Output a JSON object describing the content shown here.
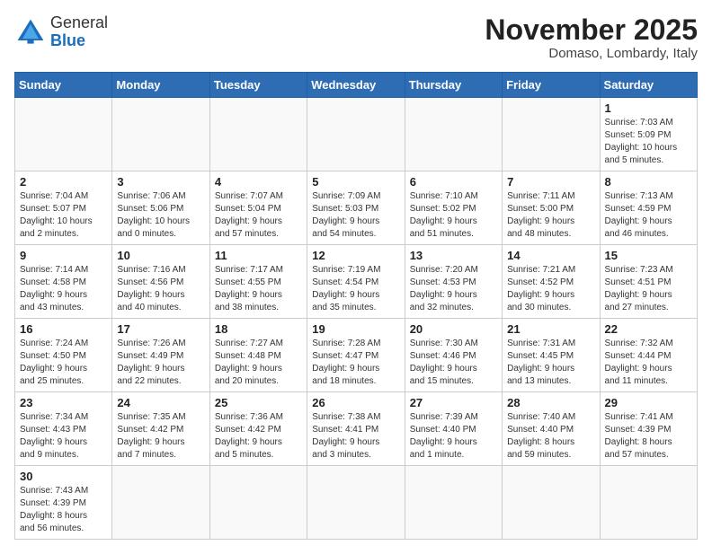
{
  "header": {
    "logo_general": "General",
    "logo_blue": "Blue",
    "month_title": "November 2025",
    "location": "Domaso, Lombardy, Italy"
  },
  "days_of_week": [
    "Sunday",
    "Monday",
    "Tuesday",
    "Wednesday",
    "Thursday",
    "Friday",
    "Saturday"
  ],
  "weeks": [
    [
      {
        "day": "",
        "info": ""
      },
      {
        "day": "",
        "info": ""
      },
      {
        "day": "",
        "info": ""
      },
      {
        "day": "",
        "info": ""
      },
      {
        "day": "",
        "info": ""
      },
      {
        "day": "",
        "info": ""
      },
      {
        "day": "1",
        "info": "Sunrise: 7:03 AM\nSunset: 5:09 PM\nDaylight: 10 hours\nand 5 minutes."
      }
    ],
    [
      {
        "day": "2",
        "info": "Sunrise: 7:04 AM\nSunset: 5:07 PM\nDaylight: 10 hours\nand 2 minutes."
      },
      {
        "day": "3",
        "info": "Sunrise: 7:06 AM\nSunset: 5:06 PM\nDaylight: 10 hours\nand 0 minutes."
      },
      {
        "day": "4",
        "info": "Sunrise: 7:07 AM\nSunset: 5:04 PM\nDaylight: 9 hours\nand 57 minutes."
      },
      {
        "day": "5",
        "info": "Sunrise: 7:09 AM\nSunset: 5:03 PM\nDaylight: 9 hours\nand 54 minutes."
      },
      {
        "day": "6",
        "info": "Sunrise: 7:10 AM\nSunset: 5:02 PM\nDaylight: 9 hours\nand 51 minutes."
      },
      {
        "day": "7",
        "info": "Sunrise: 7:11 AM\nSunset: 5:00 PM\nDaylight: 9 hours\nand 48 minutes."
      },
      {
        "day": "8",
        "info": "Sunrise: 7:13 AM\nSunset: 4:59 PM\nDaylight: 9 hours\nand 46 minutes."
      }
    ],
    [
      {
        "day": "9",
        "info": "Sunrise: 7:14 AM\nSunset: 4:58 PM\nDaylight: 9 hours\nand 43 minutes."
      },
      {
        "day": "10",
        "info": "Sunrise: 7:16 AM\nSunset: 4:56 PM\nDaylight: 9 hours\nand 40 minutes."
      },
      {
        "day": "11",
        "info": "Sunrise: 7:17 AM\nSunset: 4:55 PM\nDaylight: 9 hours\nand 38 minutes."
      },
      {
        "day": "12",
        "info": "Sunrise: 7:19 AM\nSunset: 4:54 PM\nDaylight: 9 hours\nand 35 minutes."
      },
      {
        "day": "13",
        "info": "Sunrise: 7:20 AM\nSunset: 4:53 PM\nDaylight: 9 hours\nand 32 minutes."
      },
      {
        "day": "14",
        "info": "Sunrise: 7:21 AM\nSunset: 4:52 PM\nDaylight: 9 hours\nand 30 minutes."
      },
      {
        "day": "15",
        "info": "Sunrise: 7:23 AM\nSunset: 4:51 PM\nDaylight: 9 hours\nand 27 minutes."
      }
    ],
    [
      {
        "day": "16",
        "info": "Sunrise: 7:24 AM\nSunset: 4:50 PM\nDaylight: 9 hours\nand 25 minutes."
      },
      {
        "day": "17",
        "info": "Sunrise: 7:26 AM\nSunset: 4:49 PM\nDaylight: 9 hours\nand 22 minutes."
      },
      {
        "day": "18",
        "info": "Sunrise: 7:27 AM\nSunset: 4:48 PM\nDaylight: 9 hours\nand 20 minutes."
      },
      {
        "day": "19",
        "info": "Sunrise: 7:28 AM\nSunset: 4:47 PM\nDaylight: 9 hours\nand 18 minutes."
      },
      {
        "day": "20",
        "info": "Sunrise: 7:30 AM\nSunset: 4:46 PM\nDaylight: 9 hours\nand 15 minutes."
      },
      {
        "day": "21",
        "info": "Sunrise: 7:31 AM\nSunset: 4:45 PM\nDaylight: 9 hours\nand 13 minutes."
      },
      {
        "day": "22",
        "info": "Sunrise: 7:32 AM\nSunset: 4:44 PM\nDaylight: 9 hours\nand 11 minutes."
      }
    ],
    [
      {
        "day": "23",
        "info": "Sunrise: 7:34 AM\nSunset: 4:43 PM\nDaylight: 9 hours\nand 9 minutes."
      },
      {
        "day": "24",
        "info": "Sunrise: 7:35 AM\nSunset: 4:42 PM\nDaylight: 9 hours\nand 7 minutes."
      },
      {
        "day": "25",
        "info": "Sunrise: 7:36 AM\nSunset: 4:42 PM\nDaylight: 9 hours\nand 5 minutes."
      },
      {
        "day": "26",
        "info": "Sunrise: 7:38 AM\nSunset: 4:41 PM\nDaylight: 9 hours\nand 3 minutes."
      },
      {
        "day": "27",
        "info": "Sunrise: 7:39 AM\nSunset: 4:40 PM\nDaylight: 9 hours\nand 1 minute."
      },
      {
        "day": "28",
        "info": "Sunrise: 7:40 AM\nSunset: 4:40 PM\nDaylight: 8 hours\nand 59 minutes."
      },
      {
        "day": "29",
        "info": "Sunrise: 7:41 AM\nSunset: 4:39 PM\nDaylight: 8 hours\nand 57 minutes."
      }
    ],
    [
      {
        "day": "30",
        "info": "Sunrise: 7:43 AM\nSunset: 4:39 PM\nDaylight: 8 hours\nand 56 minutes."
      },
      {
        "day": "",
        "info": ""
      },
      {
        "day": "",
        "info": ""
      },
      {
        "day": "",
        "info": ""
      },
      {
        "day": "",
        "info": ""
      },
      {
        "day": "",
        "info": ""
      },
      {
        "day": "",
        "info": ""
      }
    ]
  ]
}
